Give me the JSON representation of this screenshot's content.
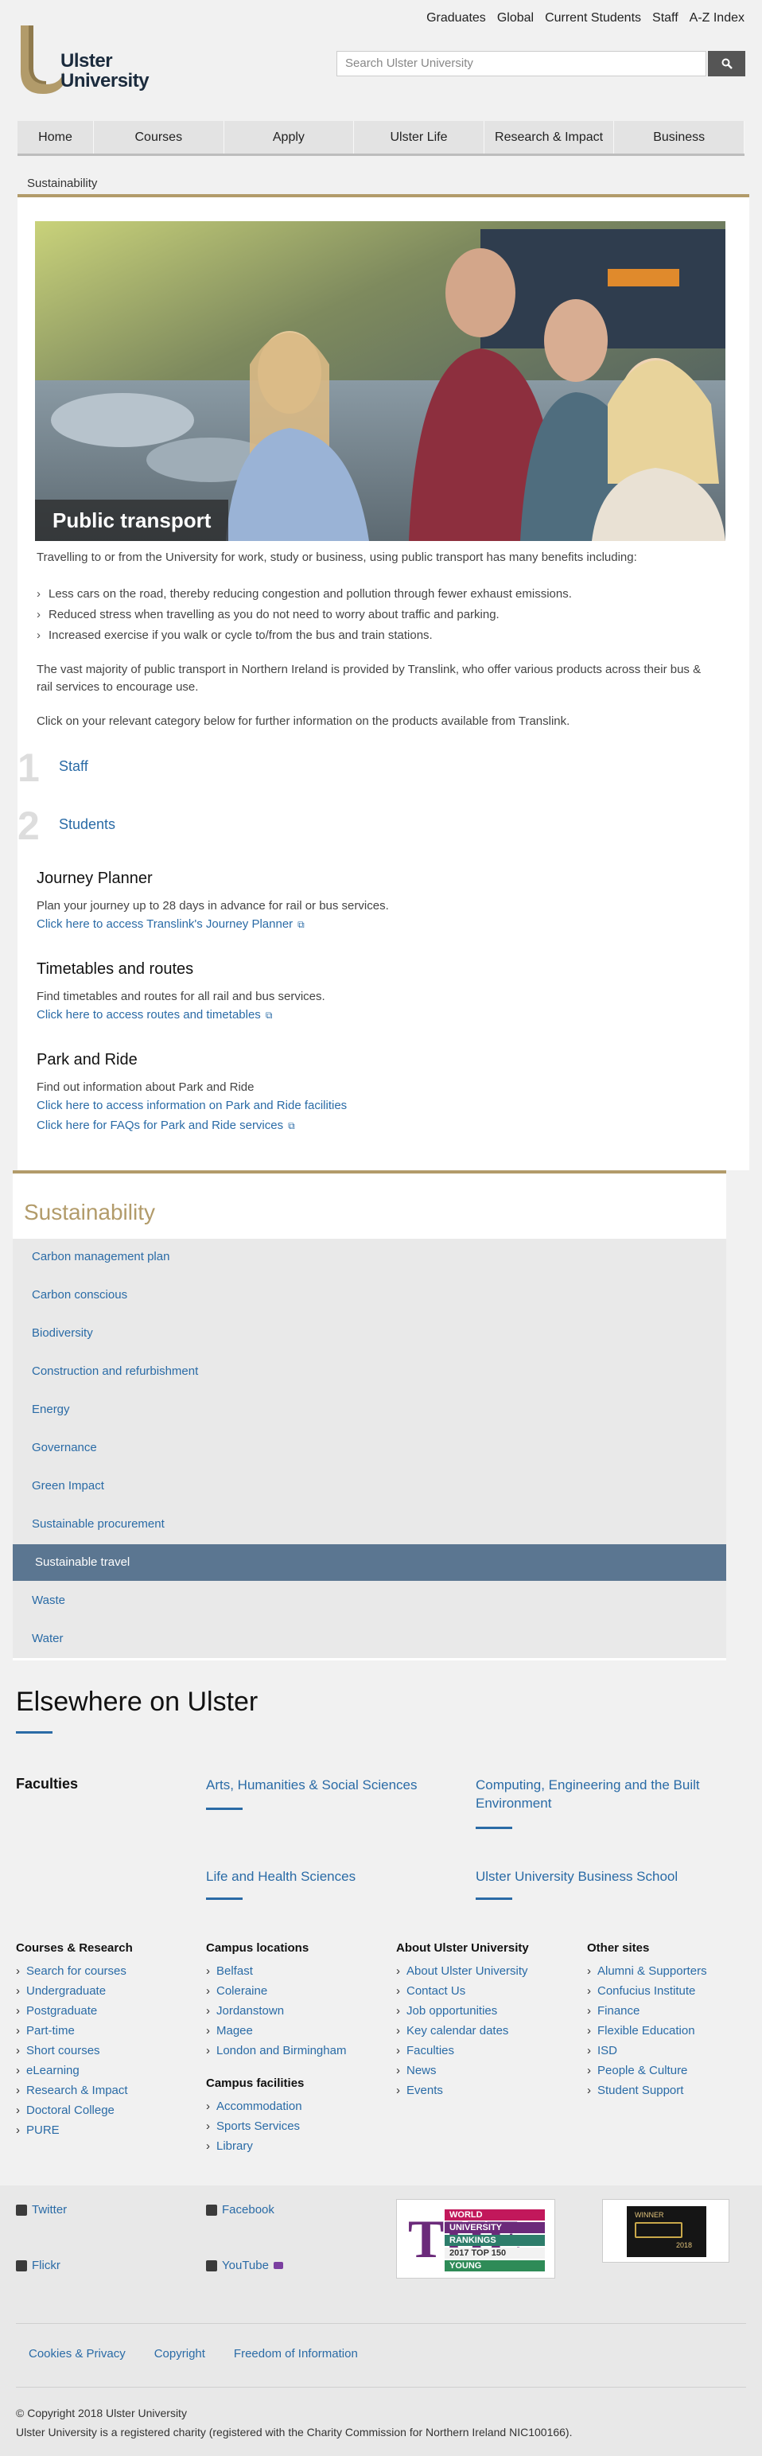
{
  "header": {
    "logo_text": "Ulster University",
    "top_links": [
      "Graduates",
      "Global",
      "Current Students",
      "Staff",
      "A-Z Index"
    ],
    "search_placeholder": "Search Ulster University"
  },
  "nav": [
    "Home",
    "Courses",
    "Apply",
    "Ulster Life",
    "Research & Impact",
    "Business"
  ],
  "breadcrumb": "Sustainability",
  "hero": {
    "title": "Public transport"
  },
  "intro": "Travelling to or from the University for work, study or business, using public transport  has many benefits including:",
  "benefits": [
    "Less cars on the road, thereby reducing congestion and  pollution through fewer exhaust emissions.",
    "Reduced stress when travelling as you do not need to worry  about traffic and parking.",
    "Increased exercise if you walk or cycle to/from the bus and  train stations."
  ],
  "translink_para": "The vast majority of public transport in Northern Ireland is provided by Translink, who offer various products across their bus & rail  services to encourage use.",
  "click_para": "Click on your relevant category below for further information  on the products available from Translink.",
  "categories": [
    {
      "num": "1",
      "label": "Staff"
    },
    {
      "num": "2",
      "label": "Students"
    }
  ],
  "sections": {
    "journey": {
      "title": "Journey Planner",
      "text": "Plan your journey up to 28 days in advance for rail or bus services.",
      "link": "Click here to access Translink's Journey Planner"
    },
    "timetables": {
      "title": "Timetables and routes",
      "text": "Find timetables and routes for all rail and bus services.",
      "link": "Click here to access routes and timetables"
    },
    "park": {
      "title": "Park and Ride",
      "text": "Find out information about Park and Ride",
      "link1": "Click here to access information on Park and Ride facilities",
      "link2": "Click here for FAQs for Park and Ride services"
    }
  },
  "sustainability": {
    "title": "Sustainability",
    "items": [
      "Carbon management plan",
      "Carbon conscious",
      "Biodiversity",
      "Construction and refurbishment",
      "Energy",
      "Governance",
      "Green Impact",
      "Sustainable procurement",
      "Sustainable travel",
      "Waste",
      "Water"
    ],
    "active": "Sustainable travel"
  },
  "elsewhere": {
    "title": "Elsewhere on Ulster",
    "faculties_label": "Faculties",
    "faculties": [
      "Arts, Humanities & Social Sciences",
      "Computing, Engineering and the Built Environment",
      "Life and Health Sciences",
      "Ulster University Business School"
    ]
  },
  "columns": {
    "courses": {
      "title": "Courses & Research",
      "items": [
        "Search for courses",
        "Undergraduate",
        "Postgraduate",
        "Part-time",
        "Short courses",
        "eLearning",
        "Research & Impact",
        "Doctoral College",
        "PURE"
      ]
    },
    "campus": {
      "title": "Campus locations",
      "items": [
        "Belfast",
        "Coleraine",
        "Jordanstown",
        "Magee",
        "London and Birmingham"
      ]
    },
    "facilities": {
      "title": "Campus facilities",
      "items": [
        "Accommodation",
        "Sports Services",
        "Library"
      ]
    },
    "about": {
      "title": "About Ulster University",
      "items": [
        "About Ulster University",
        "Contact Us",
        "Job opportunities",
        "Key calendar dates",
        "Faculties",
        "News",
        "Events"
      ]
    },
    "other": {
      "title": "Other sites",
      "items": [
        "Alumni & Supporters",
        "Confucius Institute",
        "Finance",
        "Flexible Education",
        "ISD",
        "People & Culture",
        "Student Support"
      ]
    }
  },
  "footer": {
    "social": [
      "Twitter",
      "Facebook",
      "Flickr",
      "YouTube"
    ],
    "the_badge": {
      "line1": "WORLD",
      "line2": "UNIVERSITY",
      "line3": "RANKINGS",
      "line4": "2017 TOP 150",
      "line5": "YOUNG"
    },
    "award_badge": {
      "line1": "WINNER",
      "line2": "2018"
    },
    "legal_links": [
      "Cookies & Privacy",
      "Copyright",
      "Freedom of Information"
    ],
    "copyright": "© Copyright 2018 Ulster University",
    "charity": "Ulster University is a registered charity (registered with the Charity Commission for Northern Ireland NIC100166)."
  },
  "colors": {
    "gold": "#b29b6a",
    "link": "#2a6ba6",
    "active": "#5b7691"
  }
}
